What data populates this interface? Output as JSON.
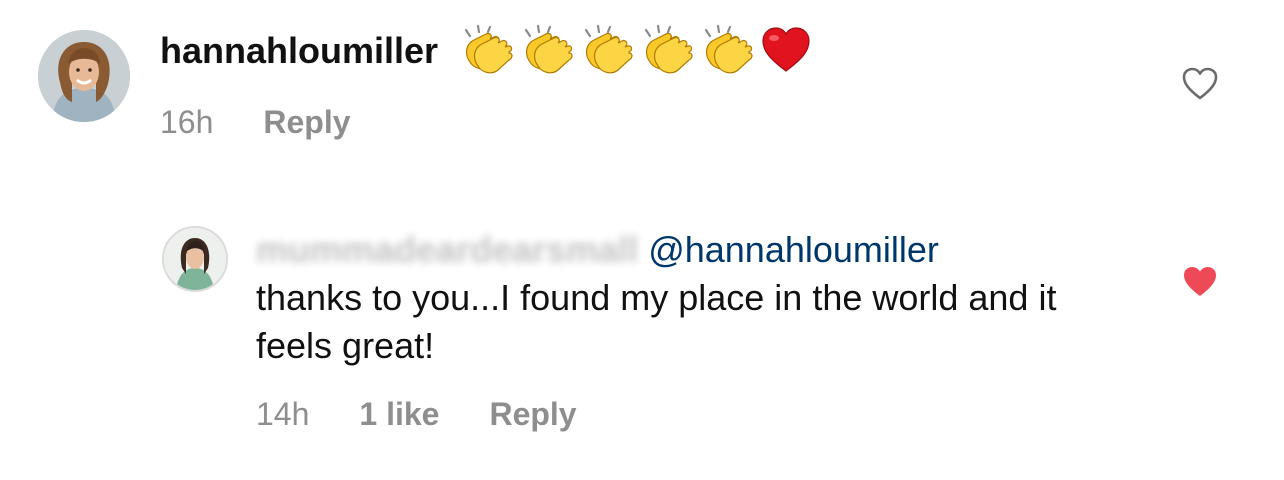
{
  "comment": {
    "username": "hannahloumiller",
    "emojis": [
      "clapping-hands",
      "clapping-hands",
      "clapping-hands",
      "clapping-hands",
      "clapping-hands",
      "red-heart"
    ],
    "time": "16h",
    "reply_label": "Reply",
    "liked": false,
    "avatar_icon": "profile-avatar"
  },
  "reply": {
    "username": "mummadeardearsmall",
    "mention": "@hannahloumiller",
    "text": "thanks to you...I found my place in the world and it feels great!",
    "time": "14h",
    "likes": "1 like",
    "reply_label": "Reply",
    "liked": true,
    "avatar_icon": "profile-avatar"
  },
  "colors": {
    "meta_text": "#8e8e8e",
    "mention": "#00376b",
    "like_active": "#ed4956",
    "like_inactive": "#262626"
  }
}
